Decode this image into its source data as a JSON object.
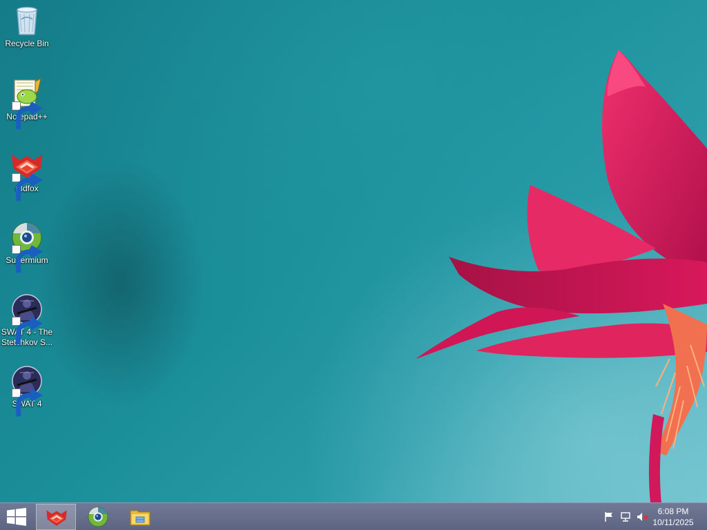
{
  "desktop": {
    "icons": [
      {
        "label": "Recycle Bin",
        "icon": "recycle-bin-icon"
      },
      {
        "label": "Notepad++",
        "icon": "notepad-plus-plus-icon"
      },
      {
        "label": "r3dfox",
        "icon": "r3dfox-icon"
      },
      {
        "label": "Supermium",
        "icon": "supermium-icon"
      },
      {
        "label": "SWAT 4 - The Stetchkov S...",
        "icon": "swat4-expansion-icon"
      },
      {
        "label": "SWAT 4",
        "icon": "swat4-icon"
      }
    ]
  },
  "taskbar": {
    "start_icon": "windows-logo-icon",
    "pinned": [
      {
        "app": "r3dfox",
        "icon": "r3dfox-icon",
        "active": true
      },
      {
        "app": "Supermium",
        "icon": "supermium-icon",
        "active": false
      },
      {
        "app": "File Explorer",
        "icon": "folder-icon",
        "active": false
      }
    ],
    "tray": {
      "icons": [
        "action-center-flag-icon",
        "network-icon",
        "volume-muted-icon"
      ],
      "time": "6:08 PM",
      "date": "10/11/2025"
    }
  },
  "colors": {
    "wallpaper": "#1e8a95",
    "flower": "#d8185a",
    "taskbar": "#6e7090"
  }
}
